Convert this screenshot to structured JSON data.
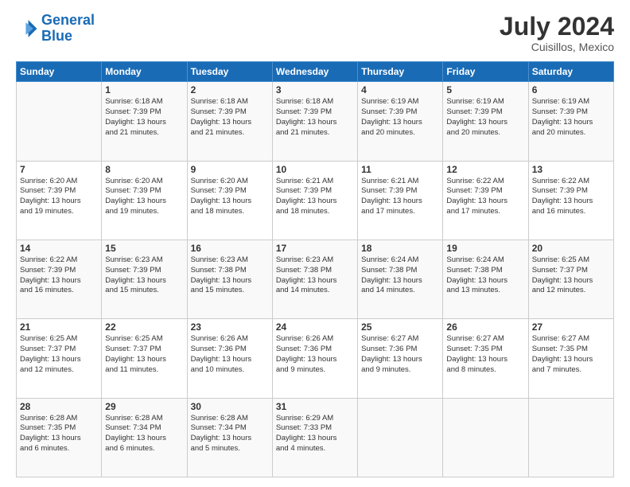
{
  "header": {
    "logo_line1": "General",
    "logo_line2": "Blue",
    "month": "July 2024",
    "location": "Cuisillos, Mexico"
  },
  "days_of_week": [
    "Sunday",
    "Monday",
    "Tuesday",
    "Wednesday",
    "Thursday",
    "Friday",
    "Saturday"
  ],
  "weeks": [
    [
      {
        "day": "",
        "info": ""
      },
      {
        "day": "1",
        "info": "Sunrise: 6:18 AM\nSunset: 7:39 PM\nDaylight: 13 hours\nand 21 minutes."
      },
      {
        "day": "2",
        "info": "Sunrise: 6:18 AM\nSunset: 7:39 PM\nDaylight: 13 hours\nand 21 minutes."
      },
      {
        "day": "3",
        "info": "Sunrise: 6:18 AM\nSunset: 7:39 PM\nDaylight: 13 hours\nand 21 minutes."
      },
      {
        "day": "4",
        "info": "Sunrise: 6:19 AM\nSunset: 7:39 PM\nDaylight: 13 hours\nand 20 minutes."
      },
      {
        "day": "5",
        "info": "Sunrise: 6:19 AM\nSunset: 7:39 PM\nDaylight: 13 hours\nand 20 minutes."
      },
      {
        "day": "6",
        "info": "Sunrise: 6:19 AM\nSunset: 7:39 PM\nDaylight: 13 hours\nand 20 minutes."
      }
    ],
    [
      {
        "day": "7",
        "info": "Sunrise: 6:20 AM\nSunset: 7:39 PM\nDaylight: 13 hours\nand 19 minutes."
      },
      {
        "day": "8",
        "info": "Sunrise: 6:20 AM\nSunset: 7:39 PM\nDaylight: 13 hours\nand 19 minutes."
      },
      {
        "day": "9",
        "info": "Sunrise: 6:20 AM\nSunset: 7:39 PM\nDaylight: 13 hours\nand 18 minutes."
      },
      {
        "day": "10",
        "info": "Sunrise: 6:21 AM\nSunset: 7:39 PM\nDaylight: 13 hours\nand 18 minutes."
      },
      {
        "day": "11",
        "info": "Sunrise: 6:21 AM\nSunset: 7:39 PM\nDaylight: 13 hours\nand 17 minutes."
      },
      {
        "day": "12",
        "info": "Sunrise: 6:22 AM\nSunset: 7:39 PM\nDaylight: 13 hours\nand 17 minutes."
      },
      {
        "day": "13",
        "info": "Sunrise: 6:22 AM\nSunset: 7:39 PM\nDaylight: 13 hours\nand 16 minutes."
      }
    ],
    [
      {
        "day": "14",
        "info": "Sunrise: 6:22 AM\nSunset: 7:39 PM\nDaylight: 13 hours\nand 16 minutes."
      },
      {
        "day": "15",
        "info": "Sunrise: 6:23 AM\nSunset: 7:39 PM\nDaylight: 13 hours\nand 15 minutes."
      },
      {
        "day": "16",
        "info": "Sunrise: 6:23 AM\nSunset: 7:38 PM\nDaylight: 13 hours\nand 15 minutes."
      },
      {
        "day": "17",
        "info": "Sunrise: 6:23 AM\nSunset: 7:38 PM\nDaylight: 13 hours\nand 14 minutes."
      },
      {
        "day": "18",
        "info": "Sunrise: 6:24 AM\nSunset: 7:38 PM\nDaylight: 13 hours\nand 14 minutes."
      },
      {
        "day": "19",
        "info": "Sunrise: 6:24 AM\nSunset: 7:38 PM\nDaylight: 13 hours\nand 13 minutes."
      },
      {
        "day": "20",
        "info": "Sunrise: 6:25 AM\nSunset: 7:37 PM\nDaylight: 13 hours\nand 12 minutes."
      }
    ],
    [
      {
        "day": "21",
        "info": "Sunrise: 6:25 AM\nSunset: 7:37 PM\nDaylight: 13 hours\nand 12 minutes."
      },
      {
        "day": "22",
        "info": "Sunrise: 6:25 AM\nSunset: 7:37 PM\nDaylight: 13 hours\nand 11 minutes."
      },
      {
        "day": "23",
        "info": "Sunrise: 6:26 AM\nSunset: 7:36 PM\nDaylight: 13 hours\nand 10 minutes."
      },
      {
        "day": "24",
        "info": "Sunrise: 6:26 AM\nSunset: 7:36 PM\nDaylight: 13 hours\nand 9 minutes."
      },
      {
        "day": "25",
        "info": "Sunrise: 6:27 AM\nSunset: 7:36 PM\nDaylight: 13 hours\nand 9 minutes."
      },
      {
        "day": "26",
        "info": "Sunrise: 6:27 AM\nSunset: 7:35 PM\nDaylight: 13 hours\nand 8 minutes."
      },
      {
        "day": "27",
        "info": "Sunrise: 6:27 AM\nSunset: 7:35 PM\nDaylight: 13 hours\nand 7 minutes."
      }
    ],
    [
      {
        "day": "28",
        "info": "Sunrise: 6:28 AM\nSunset: 7:35 PM\nDaylight: 13 hours\nand 6 minutes."
      },
      {
        "day": "29",
        "info": "Sunrise: 6:28 AM\nSunset: 7:34 PM\nDaylight: 13 hours\nand 6 minutes."
      },
      {
        "day": "30",
        "info": "Sunrise: 6:28 AM\nSunset: 7:34 PM\nDaylight: 13 hours\nand 5 minutes."
      },
      {
        "day": "31",
        "info": "Sunrise: 6:29 AM\nSunset: 7:33 PM\nDaylight: 13 hours\nand 4 minutes."
      },
      {
        "day": "",
        "info": ""
      },
      {
        "day": "",
        "info": ""
      },
      {
        "day": "",
        "info": ""
      }
    ]
  ]
}
